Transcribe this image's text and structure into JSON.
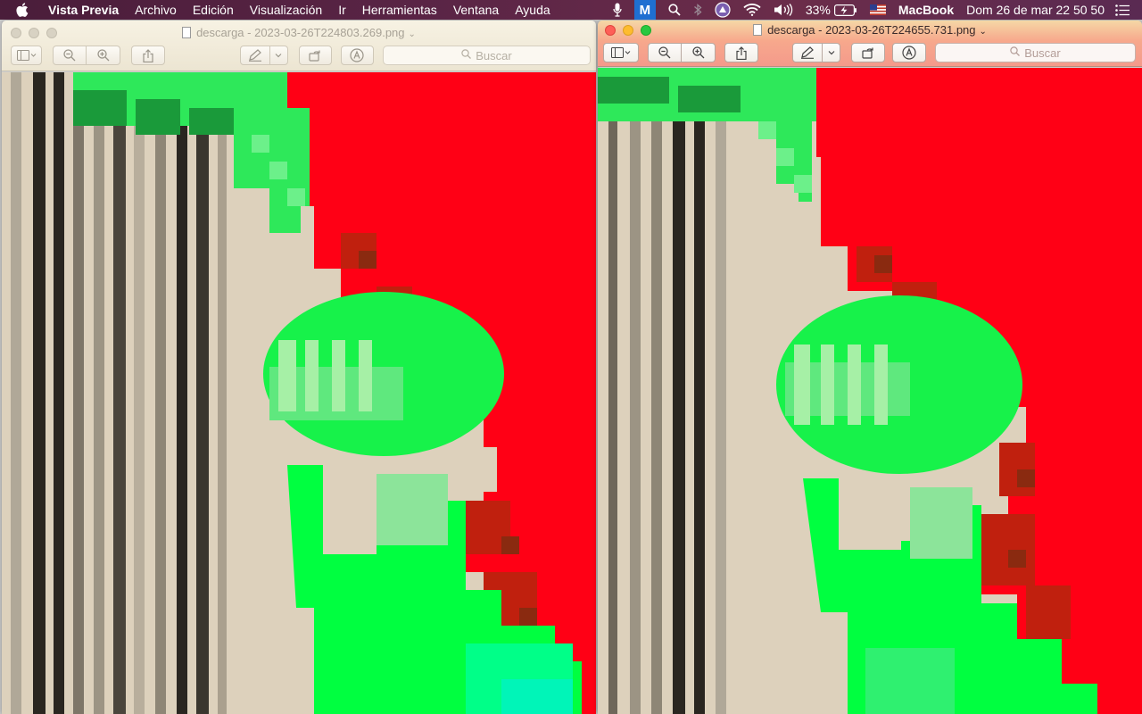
{
  "menubar": {
    "apple_icon": "apple-logo-icon",
    "app_name": "Vista Previa",
    "items": [
      "Archivo",
      "Edición",
      "Visualización",
      "Ir",
      "Herramientas",
      "Ventana",
      "Ayuda"
    ],
    "battery": "33%",
    "computer_name": "MacBook",
    "datetime": "Dom 26 de mar  22 50 50",
    "badge_letter": "M"
  },
  "left_window": {
    "title": "descarga - 2023-03-26T224803.269.png",
    "search_placeholder": "Buscar",
    "focused": false
  },
  "right_window": {
    "title": "descarga - 2023-03-26T224655.731.png",
    "search_placeholder": "Buscar",
    "focused": true
  },
  "colors": {
    "red": "#ff0015",
    "green": "#00ff40",
    "beige": "#ddd1bc",
    "dark_stripe": "#2a2620"
  }
}
